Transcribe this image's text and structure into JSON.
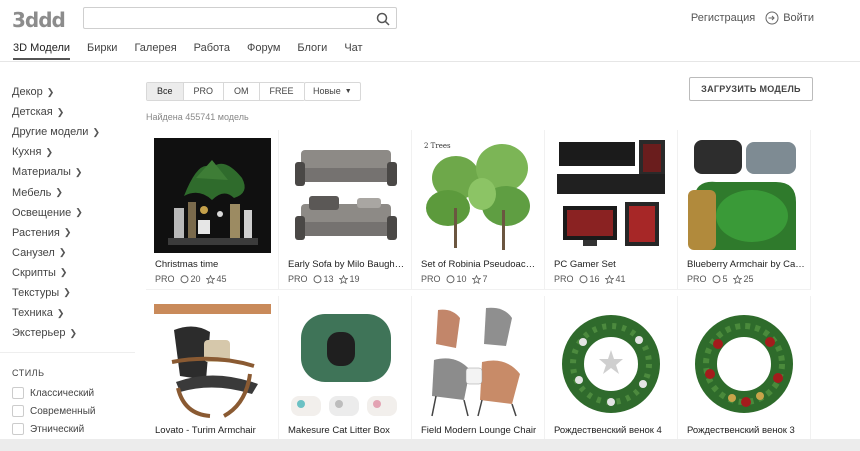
{
  "header": {
    "logo": "3ddd",
    "search_placeholder": "",
    "register": "Регистрация",
    "login": "Войти"
  },
  "nav": [
    {
      "label": "3D Модели",
      "active": true
    },
    {
      "label": "Бирки"
    },
    {
      "label": "Галерея"
    },
    {
      "label": "Работа"
    },
    {
      "label": "Форум"
    },
    {
      "label": "Блоги"
    },
    {
      "label": "Чат"
    }
  ],
  "sidebar": {
    "categories": [
      "Декор",
      "Детская",
      "Другие модели",
      "Кухня",
      "Материалы",
      "Мебель",
      "Освещение",
      "Растения",
      "Санузел",
      "Скрипты",
      "Текстуры",
      "Техника",
      "Экстерьер"
    ],
    "style_title": "СТИЛЬ",
    "styles": [
      "Классический",
      "Современный",
      "Этнический"
    ]
  },
  "filters": {
    "tabs": [
      "Все",
      "PRO",
      "OM",
      "FREE"
    ],
    "active_tab": "Все",
    "sort": "Новые",
    "upload_label": "ЗАГРУЗИТЬ МОДЕЛЬ",
    "found": "Найдена 455741 модель"
  },
  "models": [
    {
      "title": "Christmas time",
      "badge": "PRO",
      "comments": "20",
      "favorites": "45",
      "icon": "christmas-tree-scene"
    },
    {
      "title": "Early Sofa by Milo Baughman",
      "badge": "PRO",
      "comments": "13",
      "favorites": "19",
      "icon": "sofa"
    },
    {
      "title": "Set of Robinia Pseudoacacia",
      "badge": "PRO",
      "comments": "10",
      "favorites": "7",
      "icon": "trees"
    },
    {
      "title": "PC Gamer Set",
      "badge": "PRO",
      "comments": "16",
      "favorites": "41",
      "icon": "pc-set"
    },
    {
      "title": "Blueberry Armchair by Cappellini",
      "badge": "PRO",
      "comments": "5",
      "favorites": "25",
      "icon": "armchair"
    },
    {
      "title": "Lovato - Turim Armchair",
      "icon": "lounge-chair"
    },
    {
      "title": "Makesure Cat Litter Box",
      "icon": "litter-box"
    },
    {
      "title": "Field Modern Lounge Chair",
      "icon": "lounge-chairs"
    },
    {
      "title": "Рождественский венок 4",
      "icon": "wreath"
    },
    {
      "title": "Рождественский венок 3",
      "icon": "wreath"
    }
  ],
  "thumb_labels": {
    "robinia": "2 Trees"
  },
  "colors": {
    "accent": "#444444",
    "green": "#3f7a3a"
  }
}
